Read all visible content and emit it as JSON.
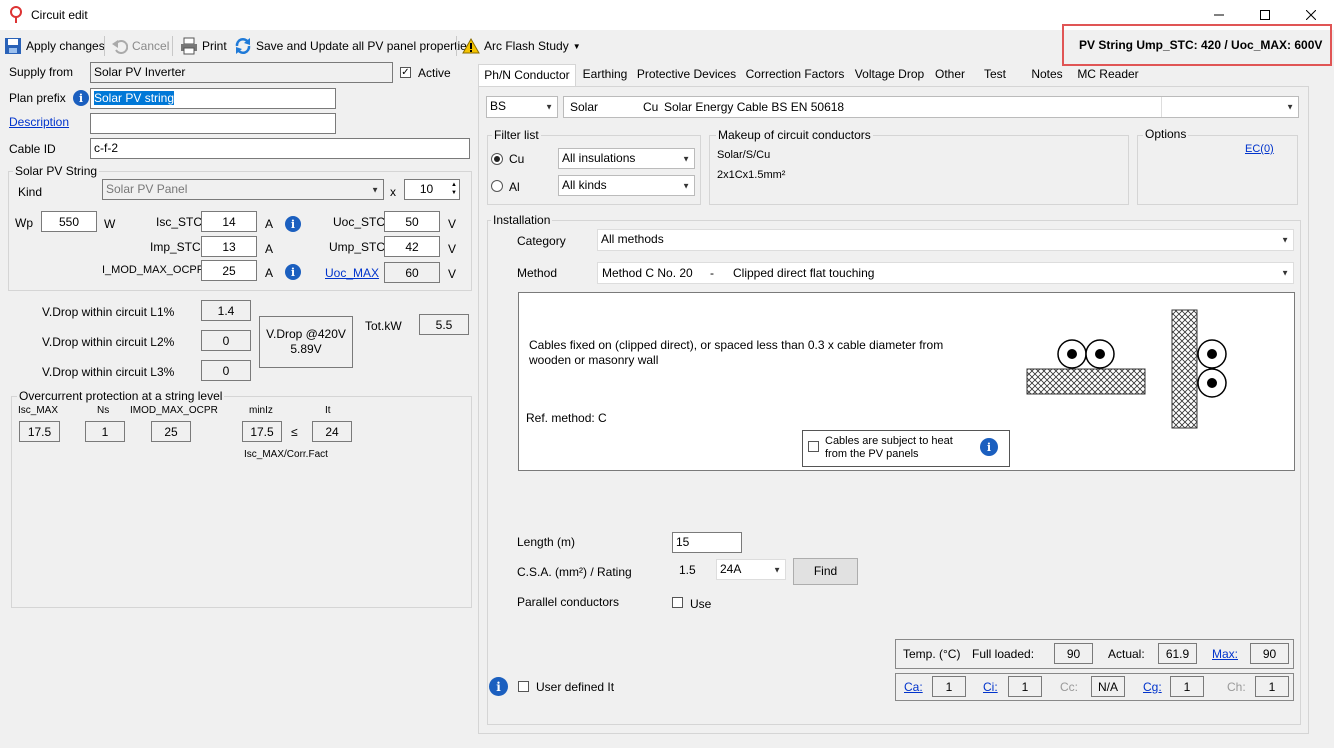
{
  "window": {
    "title": "Circuit edit",
    "controls": [
      "minimize",
      "maximize",
      "close"
    ]
  },
  "toolbar": {
    "apply": "Apply changes",
    "cancel": "Cancel",
    "print": "Print",
    "save_update": "Save and Update all PV panel properties",
    "arc_flash": "Arc Flash Study"
  },
  "highlight": {
    "text": "PV String Ump_STC: 420 / Uoc_MAX: 600V",
    "color": "#e05555"
  },
  "left": {
    "supply_from_label": "Supply from",
    "supply_from_value": "Solar PV Inverter",
    "active_label": "Active",
    "active_checked": true,
    "plan_prefix_label": "Plan prefix",
    "plan_prefix_value": "Solar PV string",
    "description_label": "Description",
    "description_value": "",
    "cable_id_label": "Cable ID",
    "cable_id_value": "c-f-2",
    "pv_group_title": "Solar PV String",
    "kind_label": "Kind",
    "kind_value": "Solar PV Panel",
    "x_label": "x",
    "count_value": "10",
    "wp_label": "Wp",
    "wp_value": "550",
    "w_unit": "W",
    "isc_label": "Isc_STC",
    "isc_value": "14",
    "imp_label": "Imp_STC",
    "imp_value": "13",
    "imod_label": "I_MOD_MAX_OCPR",
    "imod_value": "25",
    "a_unit": "A",
    "uoc_label": "Uoc_STC",
    "uoc_value": "50",
    "ump_label": "Ump_STC",
    "ump_value": "42",
    "uocmax_label": "Uoc_MAX",
    "uocmax_value": "60",
    "v_unit": "V",
    "vdrop_l1_label": "V.Drop within circuit L1%",
    "vdrop_l1_value": "1.4",
    "vdrop_l2_label": "V.Drop within circuit L2%",
    "vdrop_l2_value": "0",
    "vdrop_l3_label": "V.Drop within circuit L3%",
    "vdrop_l3_value": "0",
    "vdrop_box_line1": "V.Drop @420V",
    "vdrop_box_line2": "5.89V",
    "totkw_label": "Tot.kW",
    "totkw_value": "5.5",
    "ocp_title": "Overcurrent protection at a string level",
    "ocp_isc_label": "Isc_MAX",
    "ocp_isc_value": "17.5",
    "ocp_ns_label": "Ns",
    "ocp_ns_value": "1",
    "ocp_imod_label": "IMOD_MAX_OCPR",
    "ocp_imod_value": "25",
    "ocp_minlz_label": "minIz",
    "ocp_minlz_value": "17.5",
    "ocp_le": "≤",
    "ocp_it_label": "It",
    "ocp_it_value": "24",
    "ocp_footer": "Isc_MAX/Corr.Fact"
  },
  "tabs": [
    "Ph/N Conductor",
    "Earthing",
    "Protective Devices",
    "Correction Factors",
    "Voltage Drop",
    "Other",
    "Test",
    "Notes",
    "MC Reader"
  ],
  "conductor": {
    "standard": "BS",
    "type": "Solar",
    "material": "Cu",
    "cable_desc": "Solar Energy Cable BS EN 50618",
    "filter_title": "Filter list",
    "cu_label": "Cu",
    "al_label": "Al",
    "insulations": "All insulations",
    "kinds": "All kinds",
    "makeup_title": "Makeup of circuit conductors",
    "makeup_line1": "Solar/S/Cu",
    "makeup_line2": "2x1Cx1.5mm²",
    "options_title": "Options",
    "ec_link": "EC(0)",
    "installation_title": "Installation",
    "category_label": "Category",
    "category_value": "All methods",
    "method_label": "Method",
    "method_code": "Method C No. 20",
    "method_dash": "-",
    "method_desc": "Clipped direct flat touching",
    "desc_text": "Cables fixed on (clipped direct), or spaced less than 0.3 x cable diameter from wooden or masonry wall",
    "ref_method": "Ref. method: C",
    "heat_label": "Cables are subject to heat from the PV panels",
    "length_label": "Length (m)",
    "length_value": "15",
    "csa_label": "C.S.A. (mm²) / Rating",
    "csa_value": "1.5",
    "rating_value": "24A",
    "find_button": "Find",
    "parallel_label": "Parallel conductors",
    "use_label": "Use",
    "temp_label": "Temp. (°C)",
    "full_loaded_label": "Full loaded:",
    "full_loaded_value": "90",
    "actual_label": "Actual:",
    "actual_value": "61.9",
    "max_label": "Max:",
    "max_value": "90",
    "ca_label": "Ca:",
    "ca_value": "1",
    "ci_label": "Ci:",
    "ci_value": "1",
    "cc_label": "Cc:",
    "cc_value": "N/A",
    "cg_label": "Cg:",
    "cg_value": "1",
    "ch_label": "Ch:",
    "ch_value": "1",
    "user_defined_label": "User defined It"
  }
}
